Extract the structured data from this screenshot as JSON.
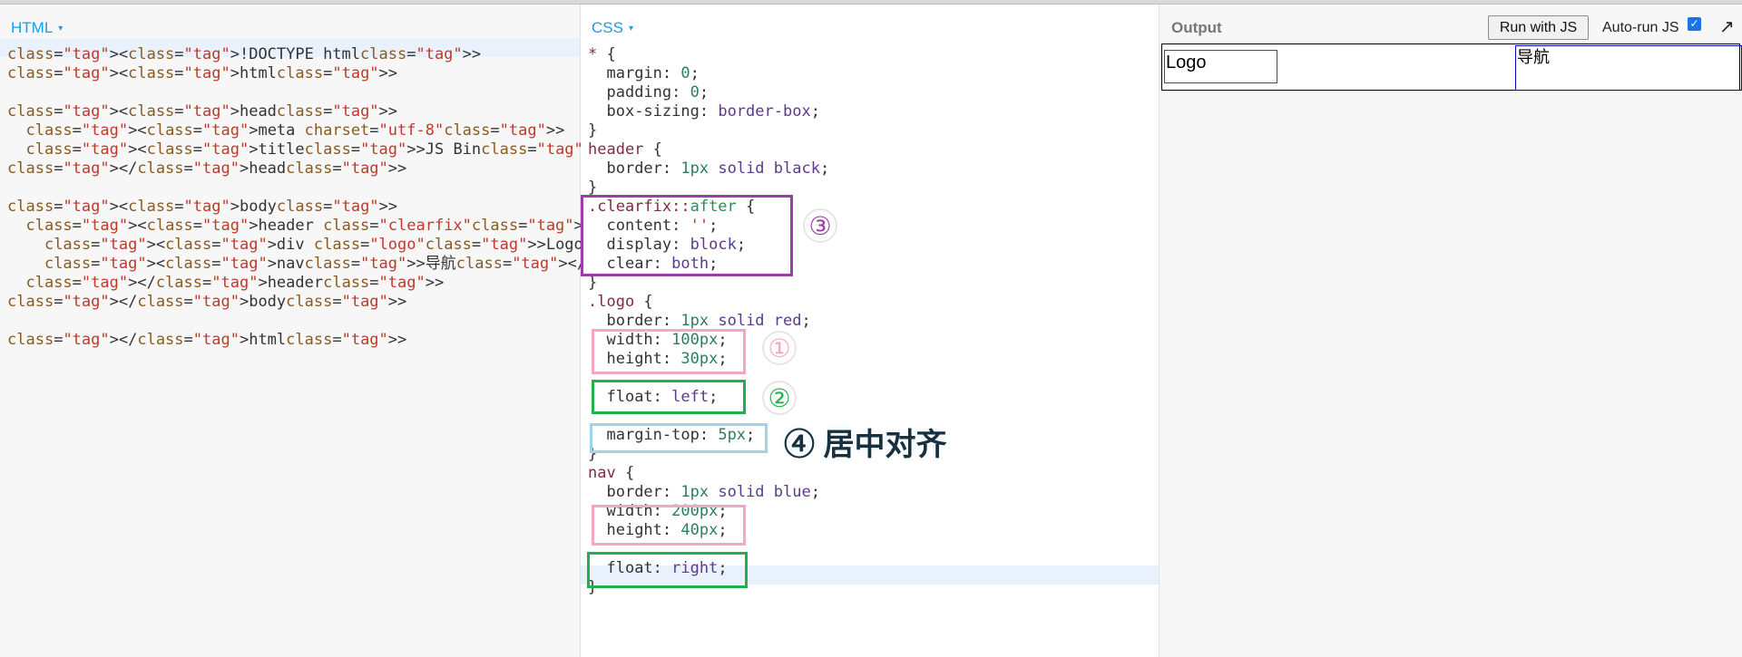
{
  "html_pane": {
    "title": "HTML",
    "caret": "▾",
    "lines": [
      "<!DOCTYPE html>",
      "<html>",
      "",
      "<head>",
      "  <meta charset=\"utf-8\">",
      "  <title>JS Bin</title>",
      "</head>",
      "",
      "<body>",
      "  <header class=\"clearfix\">",
      "    <div class=\"logo\">Logo</div>",
      "    <nav>导航</nav>",
      "  </header>",
      "</body>",
      "",
      "</html>"
    ]
  },
  "css_pane": {
    "title": "CSS",
    "caret": "▾",
    "lines": [
      "* {",
      "  margin: 0;",
      "  padding: 0;",
      "  box-sizing: border-box;",
      "}",
      "header {",
      "  border: 1px solid black;",
      "}",
      ".clearfix::after {",
      "  content: '';",
      "  display: block;",
      "  clear: both;",
      "}",
      ".logo {",
      "  border: 1px solid red;",
      "  width: 100px;",
      "  height: 30px;",
      "",
      "  float: left;",
      "",
      "  margin-top: 5px;",
      "}",
      "nav {",
      "  border: 1px solid blue;",
      "  width: 200px;",
      "  height: 40px;",
      "",
      "  float: right;",
      "}"
    ]
  },
  "annotations": {
    "badge_1": "①",
    "badge_2": "②",
    "badge_3": "③",
    "note_4": "④ 居中对齐",
    "colors": {
      "pink": "#f4a7c3",
      "green": "#22b04c",
      "purple": "#9b3fa6",
      "lightblue": "#9fd3ea"
    }
  },
  "output_pane": {
    "title": "Output",
    "run_button": "Run with JS",
    "auto_run_label": "Auto-run JS",
    "auto_run_checked": true,
    "expand_icon": "↗",
    "result": {
      "logo_text": "Logo",
      "nav_text": "导航"
    }
  }
}
